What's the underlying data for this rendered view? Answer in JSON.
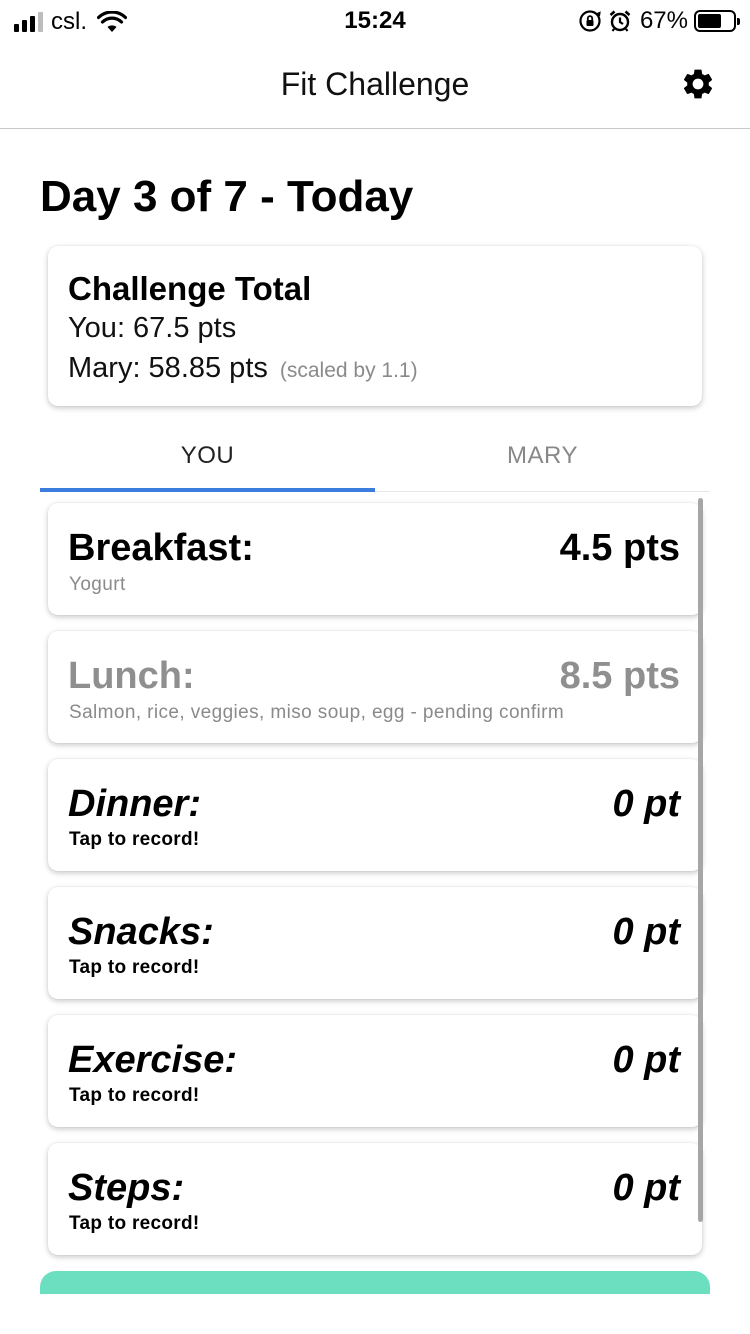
{
  "status_bar": {
    "carrier": "csl.",
    "time": "15:24",
    "battery_percent": "67%",
    "battery_level": 0.67,
    "icons": [
      "signal-icon",
      "wifi-icon",
      "orientation-lock-icon",
      "alarm-icon",
      "battery-icon"
    ]
  },
  "header": {
    "title": "Fit Challenge",
    "settings_icon": "gear-icon"
  },
  "day_title": "Day 3 of 7 - Today",
  "challenge_total": {
    "title": "Challenge Total",
    "you_line": "You: 67.5 pts",
    "mary_line": "Mary: 58.85 pts",
    "scaled_note": "(scaled by 1.1)"
  },
  "tabs": [
    {
      "label": "YOU",
      "active": true
    },
    {
      "label": "MARY",
      "active": false
    }
  ],
  "meals": [
    {
      "name": "Breakfast:",
      "points": "4.5 pts",
      "detail": "Yogurt",
      "state": "recorded"
    },
    {
      "name": "Lunch:",
      "points": "8.5 pts",
      "detail": "Salmon, rice, veggies, miso soup, egg - pending confirm",
      "state": "pending"
    },
    {
      "name": "Dinner:",
      "points": "0 pt",
      "detail": "Tap to record!",
      "state": "empty"
    },
    {
      "name": "Snacks:",
      "points": "0 pt",
      "detail": "Tap to record!",
      "state": "empty"
    },
    {
      "name": "Exercise:",
      "points": "0 pt",
      "detail": "Tap to record!",
      "state": "empty"
    },
    {
      "name": "Steps:",
      "points": "0 pt",
      "detail": "Tap to record!",
      "state": "empty"
    }
  ],
  "colors": {
    "tab_indicator": "#3b7ddd",
    "bottom_button": "#6ddfc1",
    "pending_text": "#8f8f8f"
  }
}
